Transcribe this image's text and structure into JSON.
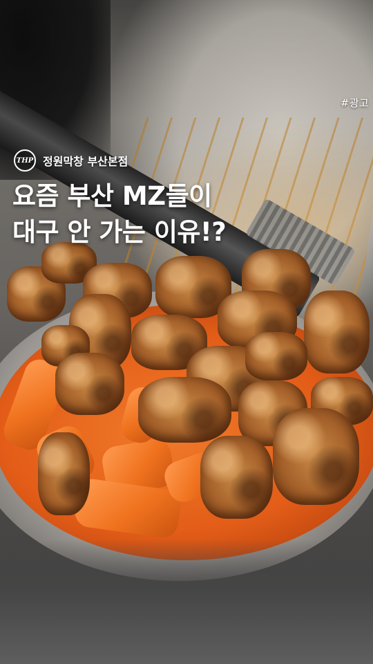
{
  "ad_tag": "#광고",
  "brand": {
    "logo_text": "THP",
    "name": "정원막창 부산본점"
  },
  "headline": {
    "line1": "요즘 부산 MZ들이",
    "line2": "대구 안 가는 이유!?"
  },
  "photo": {
    "subject": "grilled chicken and tteok in sauce pan"
  },
  "colors": {
    "text": "#ffffff",
    "sauce": "#e35d18"
  }
}
